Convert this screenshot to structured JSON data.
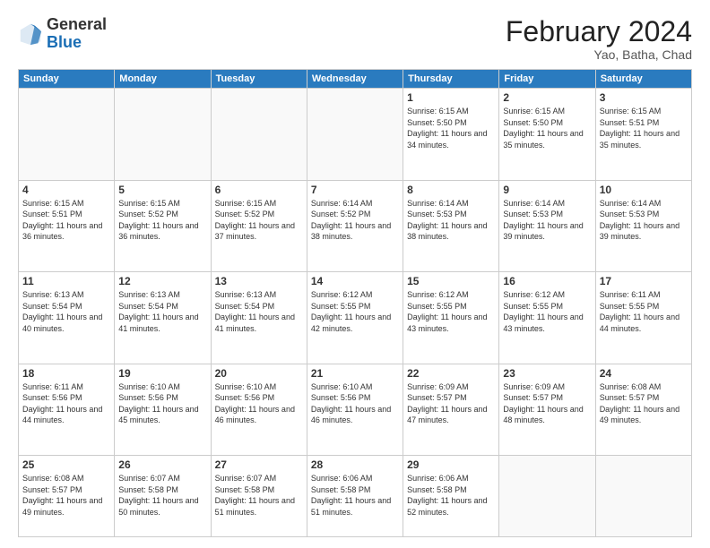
{
  "header": {
    "logo_general": "General",
    "logo_blue": "Blue",
    "title": "February 2024",
    "subtitle": "Yao, Batha, Chad"
  },
  "days_of_week": [
    "Sunday",
    "Monday",
    "Tuesday",
    "Wednesday",
    "Thursday",
    "Friday",
    "Saturday"
  ],
  "weeks": [
    [
      {
        "day": "",
        "sunrise": "",
        "sunset": "",
        "daylight": "",
        "empty": true
      },
      {
        "day": "",
        "sunrise": "",
        "sunset": "",
        "daylight": "",
        "empty": true
      },
      {
        "day": "",
        "sunrise": "",
        "sunset": "",
        "daylight": "",
        "empty": true
      },
      {
        "day": "",
        "sunrise": "",
        "sunset": "",
        "daylight": "",
        "empty": true
      },
      {
        "day": "1",
        "sunrise": "Sunrise: 6:15 AM",
        "sunset": "Sunset: 5:50 PM",
        "daylight": "Daylight: 11 hours and 34 minutes."
      },
      {
        "day": "2",
        "sunrise": "Sunrise: 6:15 AM",
        "sunset": "Sunset: 5:50 PM",
        "daylight": "Daylight: 11 hours and 35 minutes."
      },
      {
        "day": "3",
        "sunrise": "Sunrise: 6:15 AM",
        "sunset": "Sunset: 5:51 PM",
        "daylight": "Daylight: 11 hours and 35 minutes."
      }
    ],
    [
      {
        "day": "4",
        "sunrise": "Sunrise: 6:15 AM",
        "sunset": "Sunset: 5:51 PM",
        "daylight": "Daylight: 11 hours and 36 minutes."
      },
      {
        "day": "5",
        "sunrise": "Sunrise: 6:15 AM",
        "sunset": "Sunset: 5:52 PM",
        "daylight": "Daylight: 11 hours and 36 minutes."
      },
      {
        "day": "6",
        "sunrise": "Sunrise: 6:15 AM",
        "sunset": "Sunset: 5:52 PM",
        "daylight": "Daylight: 11 hours and 37 minutes."
      },
      {
        "day": "7",
        "sunrise": "Sunrise: 6:14 AM",
        "sunset": "Sunset: 5:52 PM",
        "daylight": "Daylight: 11 hours and 38 minutes."
      },
      {
        "day": "8",
        "sunrise": "Sunrise: 6:14 AM",
        "sunset": "Sunset: 5:53 PM",
        "daylight": "Daylight: 11 hours and 38 minutes."
      },
      {
        "day": "9",
        "sunrise": "Sunrise: 6:14 AM",
        "sunset": "Sunset: 5:53 PM",
        "daylight": "Daylight: 11 hours and 39 minutes."
      },
      {
        "day": "10",
        "sunrise": "Sunrise: 6:14 AM",
        "sunset": "Sunset: 5:53 PM",
        "daylight": "Daylight: 11 hours and 39 minutes."
      }
    ],
    [
      {
        "day": "11",
        "sunrise": "Sunrise: 6:13 AM",
        "sunset": "Sunset: 5:54 PM",
        "daylight": "Daylight: 11 hours and 40 minutes."
      },
      {
        "day": "12",
        "sunrise": "Sunrise: 6:13 AM",
        "sunset": "Sunset: 5:54 PM",
        "daylight": "Daylight: 11 hours and 41 minutes."
      },
      {
        "day": "13",
        "sunrise": "Sunrise: 6:13 AM",
        "sunset": "Sunset: 5:54 PM",
        "daylight": "Daylight: 11 hours and 41 minutes."
      },
      {
        "day": "14",
        "sunrise": "Sunrise: 6:12 AM",
        "sunset": "Sunset: 5:55 PM",
        "daylight": "Daylight: 11 hours and 42 minutes."
      },
      {
        "day": "15",
        "sunrise": "Sunrise: 6:12 AM",
        "sunset": "Sunset: 5:55 PM",
        "daylight": "Daylight: 11 hours and 43 minutes."
      },
      {
        "day": "16",
        "sunrise": "Sunrise: 6:12 AM",
        "sunset": "Sunset: 5:55 PM",
        "daylight": "Daylight: 11 hours and 43 minutes."
      },
      {
        "day": "17",
        "sunrise": "Sunrise: 6:11 AM",
        "sunset": "Sunset: 5:55 PM",
        "daylight": "Daylight: 11 hours and 44 minutes."
      }
    ],
    [
      {
        "day": "18",
        "sunrise": "Sunrise: 6:11 AM",
        "sunset": "Sunset: 5:56 PM",
        "daylight": "Daylight: 11 hours and 44 minutes."
      },
      {
        "day": "19",
        "sunrise": "Sunrise: 6:10 AM",
        "sunset": "Sunset: 5:56 PM",
        "daylight": "Daylight: 11 hours and 45 minutes."
      },
      {
        "day": "20",
        "sunrise": "Sunrise: 6:10 AM",
        "sunset": "Sunset: 5:56 PM",
        "daylight": "Daylight: 11 hours and 46 minutes."
      },
      {
        "day": "21",
        "sunrise": "Sunrise: 6:10 AM",
        "sunset": "Sunset: 5:56 PM",
        "daylight": "Daylight: 11 hours and 46 minutes."
      },
      {
        "day": "22",
        "sunrise": "Sunrise: 6:09 AM",
        "sunset": "Sunset: 5:57 PM",
        "daylight": "Daylight: 11 hours and 47 minutes."
      },
      {
        "day": "23",
        "sunrise": "Sunrise: 6:09 AM",
        "sunset": "Sunset: 5:57 PM",
        "daylight": "Daylight: 11 hours and 48 minutes."
      },
      {
        "day": "24",
        "sunrise": "Sunrise: 6:08 AM",
        "sunset": "Sunset: 5:57 PM",
        "daylight": "Daylight: 11 hours and 49 minutes."
      }
    ],
    [
      {
        "day": "25",
        "sunrise": "Sunrise: 6:08 AM",
        "sunset": "Sunset: 5:57 PM",
        "daylight": "Daylight: 11 hours and 49 minutes."
      },
      {
        "day": "26",
        "sunrise": "Sunrise: 6:07 AM",
        "sunset": "Sunset: 5:58 PM",
        "daylight": "Daylight: 11 hours and 50 minutes."
      },
      {
        "day": "27",
        "sunrise": "Sunrise: 6:07 AM",
        "sunset": "Sunset: 5:58 PM",
        "daylight": "Daylight: 11 hours and 51 minutes."
      },
      {
        "day": "28",
        "sunrise": "Sunrise: 6:06 AM",
        "sunset": "Sunset: 5:58 PM",
        "daylight": "Daylight: 11 hours and 51 minutes."
      },
      {
        "day": "29",
        "sunrise": "Sunrise: 6:06 AM",
        "sunset": "Sunset: 5:58 PM",
        "daylight": "Daylight: 11 hours and 52 minutes."
      },
      {
        "day": "",
        "sunrise": "",
        "sunset": "",
        "daylight": "",
        "empty": true
      },
      {
        "day": "",
        "sunrise": "",
        "sunset": "",
        "daylight": "",
        "empty": true
      }
    ]
  ]
}
